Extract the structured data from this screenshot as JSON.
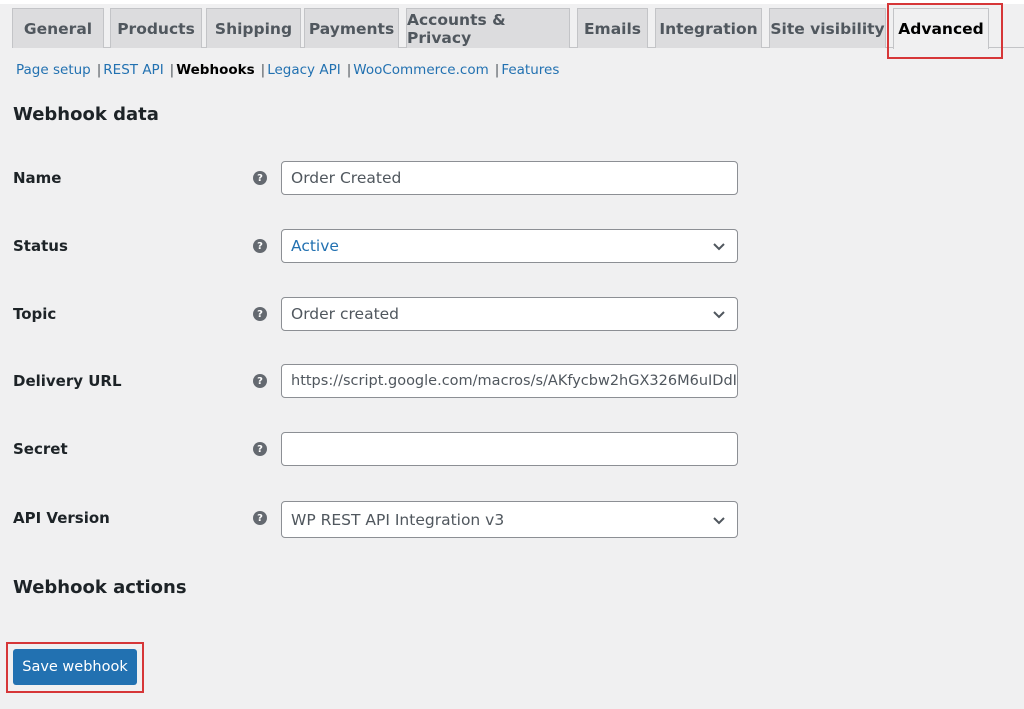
{
  "tabs": [
    {
      "label": "General",
      "active": false
    },
    {
      "label": "Products",
      "active": false
    },
    {
      "label": "Shipping",
      "active": false
    },
    {
      "label": "Payments",
      "active": false
    },
    {
      "label": "Accounts & Privacy",
      "active": false
    },
    {
      "label": "Emails",
      "active": false
    },
    {
      "label": "Integration",
      "active": false
    },
    {
      "label": "Site visibility",
      "active": false
    },
    {
      "label": "Advanced",
      "active": true
    }
  ],
  "subnav": [
    {
      "label": "Page setup",
      "current": false
    },
    {
      "label": "REST API",
      "current": false
    },
    {
      "label": "Webhooks",
      "current": true
    },
    {
      "label": "Legacy API",
      "current": false
    },
    {
      "label": "WooCommerce.com",
      "current": false
    },
    {
      "label": "Features",
      "current": false
    }
  ],
  "subnav_separator": "|",
  "webhook_data": {
    "heading": "Webhook data",
    "help_glyph": "?",
    "fields": {
      "name": {
        "label": "Name",
        "value": "Order Created"
      },
      "status": {
        "label": "Status",
        "value": "Active"
      },
      "topic": {
        "label": "Topic",
        "value": "Order created"
      },
      "delivery_url": {
        "label": "Delivery URL",
        "value": "https://script.google.com/macros/s/AKfycbw2hGX326M6uIDdI"
      },
      "secret": {
        "label": "Secret",
        "value": ""
      },
      "api_version": {
        "label": "API Version",
        "value": "WP REST API Integration v3"
      }
    }
  },
  "webhook_actions": {
    "heading": "Webhook actions",
    "save_label": "Save webhook"
  },
  "colors": {
    "accent": "#2271b1",
    "highlight": "#d63638",
    "background": "#f0f0f1"
  }
}
